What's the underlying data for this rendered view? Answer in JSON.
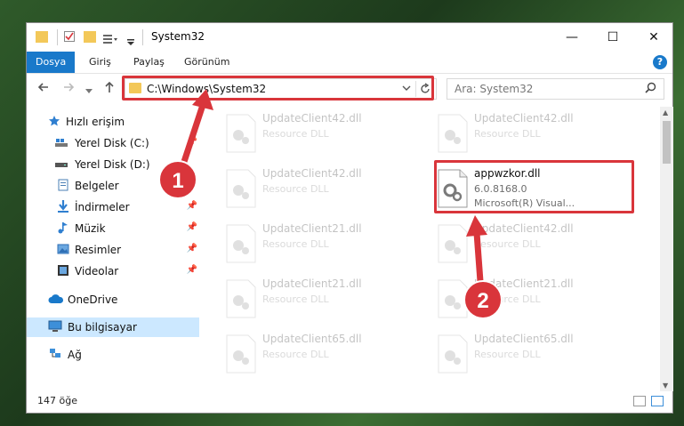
{
  "window": {
    "title": "System32",
    "controls": {
      "minimize": "—",
      "maximize": "☐",
      "close": "✕"
    }
  },
  "ribbon": {
    "tabs": [
      "Dosya",
      "Giriş",
      "Paylaş",
      "Görünüm"
    ],
    "help": "?"
  },
  "address": {
    "path": "C:\\Windows\\System32",
    "search_placeholder": "Ara: System32"
  },
  "sidebar": {
    "items": [
      {
        "label": "Hızlı erişim"
      },
      {
        "label": "Yerel Disk (C:)"
      },
      {
        "label": "Yerel Disk (D:)"
      },
      {
        "label": "Belgeler"
      },
      {
        "label": "İndirmeler"
      },
      {
        "label": "Müzik"
      },
      {
        "label": "Resimler"
      },
      {
        "label": "Videolar"
      },
      {
        "label": "OneDrive"
      },
      {
        "label": "Bu bilgisayar"
      },
      {
        "label": "Ağ"
      }
    ]
  },
  "files": [
    {
      "name": "UpdateClient42.dll",
      "sub1": "Resource DLL",
      "sub2": ""
    },
    {
      "name": "UpdateClient42.dll",
      "sub1": "Resource DLL",
      "sub2": ""
    },
    {
      "name": "UpdateClient42.dll",
      "sub1": "Resource DLL",
      "sub2": ""
    },
    {
      "name": "appwzkor.dll",
      "sub1": "6.0.8168.0",
      "sub2": "Microsoft(R) Visual..."
    },
    {
      "name": "UpdateClient21.dll",
      "sub1": "Resource DLL",
      "sub2": ""
    },
    {
      "name": "UpdateClient42.dll",
      "sub1": "Resource DLL",
      "sub2": ""
    },
    {
      "name": "UpdateClient21.dll",
      "sub1": "Resource DLL",
      "sub2": ""
    },
    {
      "name": "UpdateClient21.dll",
      "sub1": "Resource DLL",
      "sub2": ""
    },
    {
      "name": "UpdateClient65.dll",
      "sub1": "Resource DLL",
      "sub2": ""
    },
    {
      "name": "UpdateClient65.dll",
      "sub1": "Resource DLL",
      "sub2": ""
    }
  ],
  "status": {
    "count": "147 öğe"
  },
  "annotations": {
    "step1": "1",
    "step2": "2"
  },
  "colors": {
    "accent": "#1979ca",
    "highlight": "#d9353b",
    "selected": "#cce8ff"
  }
}
